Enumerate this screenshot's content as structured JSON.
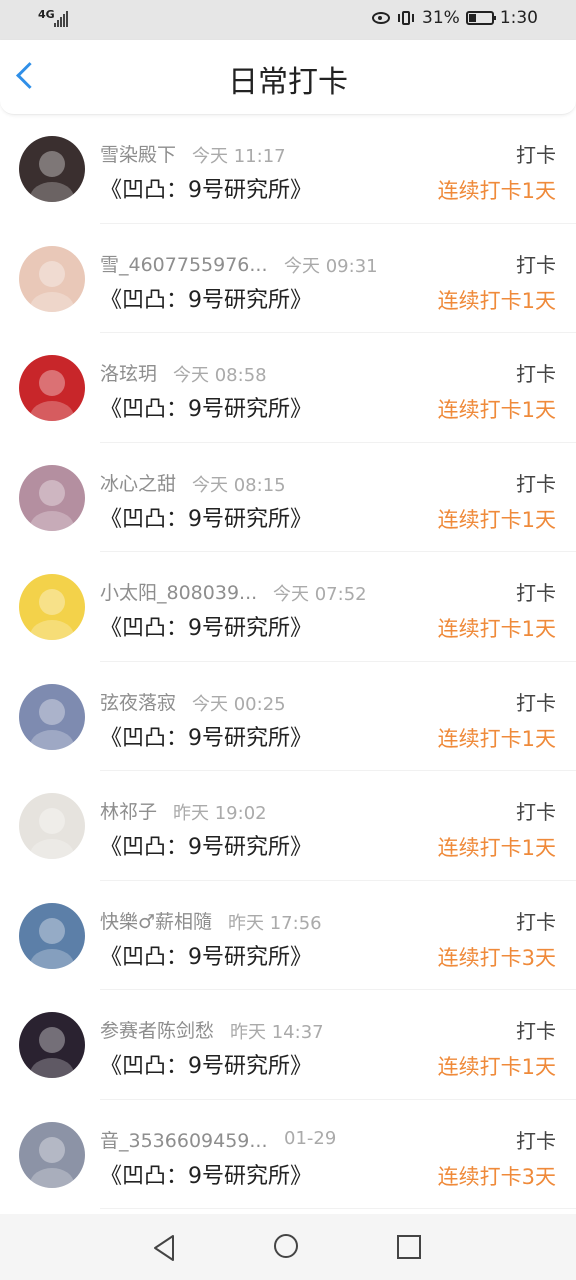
{
  "status_bar": {
    "network": "4G",
    "battery_percent": "31%",
    "time": "1:30",
    "battery_level": 0.31
  },
  "header": {
    "title": "日常打卡",
    "back_icon": "chevron-left-icon",
    "accent": "#2f8fe8"
  },
  "colors": {
    "streak": "#ef8a3a",
    "name": "#8e8e8e",
    "time": "#aaaaaa"
  },
  "checkins": [
    {
      "name": "雪染殿下",
      "time": "今天 11:17",
      "action": "打卡",
      "subject": "《凹凸：9号研究所》",
      "streak": "连续打卡1天",
      "avatar_color": "#3a2f2f"
    },
    {
      "name": "雪_4607755976...",
      "time": "今天 09:31",
      "action": "打卡",
      "subject": "《凹凸：9号研究所》",
      "streak": "连续打卡1天",
      "avatar_color": "#e9c8b8"
    },
    {
      "name": "洛玹玥",
      "time": "今天 08:58",
      "action": "打卡",
      "subject": "《凹凸：9号研究所》",
      "streak": "连续打卡1天",
      "avatar_color": "#c8262a"
    },
    {
      "name": "冰心之甜",
      "time": "今天 08:15",
      "action": "打卡",
      "subject": "《凹凸：9号研究所》",
      "streak": "连续打卡1天",
      "avatar_color": "#b48fa0"
    },
    {
      "name": "小太阳_808039...",
      "time": "今天 07:52",
      "action": "打卡",
      "subject": "《凹凸：9号研究所》",
      "streak": "连续打卡1天",
      "avatar_color": "#f3d24a"
    },
    {
      "name": "弦夜落寂",
      "time": "今天 00:25",
      "action": "打卡",
      "subject": "《凹凸：9号研究所》",
      "streak": "连续打卡1天",
      "avatar_color": "#7e8bb0"
    },
    {
      "name": "林祁子",
      "time": "昨天 19:02",
      "action": "打卡",
      "subject": "《凹凸：9号研究所》",
      "streak": "连续打卡1天",
      "avatar_color": "#e6e3de"
    },
    {
      "name": "快樂♂薪相隨",
      "time": "昨天 17:56",
      "action": "打卡",
      "subject": "《凹凸：9号研究所》",
      "streak": "连续打卡3天",
      "avatar_color": "#5c7fa8"
    },
    {
      "name": "参赛者陈剑愁",
      "time": "昨天 14:37",
      "action": "打卡",
      "subject": "《凹凸：9号研究所》",
      "streak": "连续打卡1天",
      "avatar_color": "#2a2230"
    },
    {
      "name": "音_3536609459...",
      "time": "01-29",
      "action": "打卡",
      "subject": "《凹凸：9号研究所》",
      "streak": "连续打卡3天",
      "avatar_color": "#8c93a6"
    }
  ],
  "nav_bar": {
    "back_icon": "triangle-back-icon",
    "home_icon": "circle-home-icon",
    "recents_icon": "square-recents-icon"
  }
}
